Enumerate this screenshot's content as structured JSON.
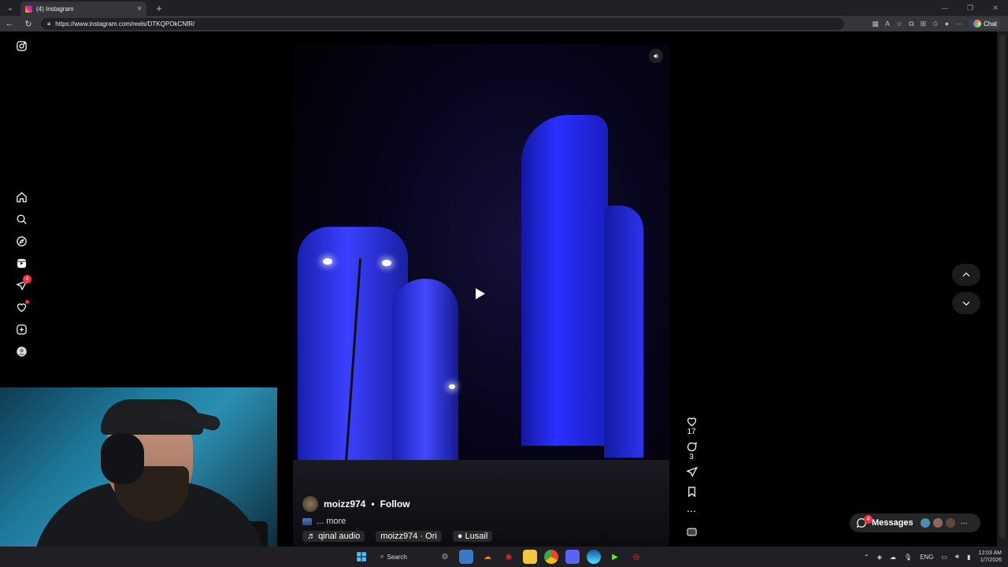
{
  "browser": {
    "tab_title": "(4) Instagram",
    "url": "https://www.instagram.com/reels/DTKQPOkCNfR/",
    "chat_label": "Chat"
  },
  "sidebar": {
    "notifications_badge": "4",
    "items": [
      {
        "name": "home-icon"
      },
      {
        "name": "search-icon"
      },
      {
        "name": "explore-icon"
      },
      {
        "name": "reels-icon"
      },
      {
        "name": "messages-icon"
      },
      {
        "name": "notifications-icon"
      },
      {
        "name": "create-icon"
      },
      {
        "name": "profile-icon"
      }
    ]
  },
  "reel": {
    "username": "moizz974",
    "separator": "•",
    "follow_label": "Follow",
    "caption_more": "... more",
    "audio_label": "qinal audio",
    "audio_credit": "moizz974 · Ori",
    "location": "Lusail",
    "likes": "17",
    "comments": "3"
  },
  "messages": {
    "label": "Messages",
    "badge": "4"
  },
  "taskbar": {
    "search_label": "Search",
    "language": "ENG",
    "time": "12:03 AM",
    "date": "1/7/2026"
  },
  "colors": {
    "tower_blue": "#2a2fd8",
    "badge_red": "#ff3040",
    "page_bg": "#000000"
  }
}
